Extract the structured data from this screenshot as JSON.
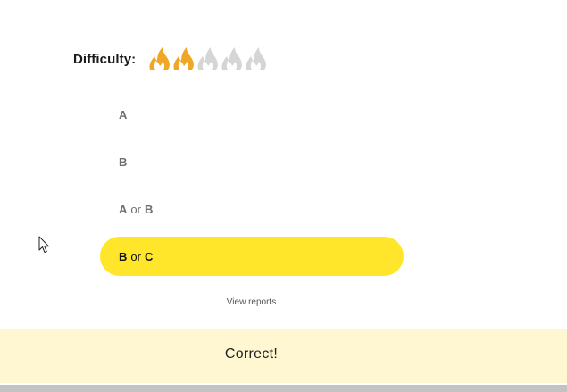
{
  "difficulty": {
    "label": "Difficulty:",
    "level": 2,
    "max": 5,
    "icon": "flame-icon",
    "active_color": "#f0a725",
    "inactive_color": "#d5d5d5"
  },
  "options": [
    {
      "first": "A",
      "join": "",
      "second": ""
    },
    {
      "first": "B",
      "join": "",
      "second": ""
    },
    {
      "first": "A",
      "join": "or",
      "second": "B"
    },
    {
      "first": "B",
      "join": "or",
      "second": "C"
    }
  ],
  "selected_option_index": 3,
  "selected_color": "#ffe62b",
  "view_reports_label": "View reports",
  "feedback": {
    "text": "Correct!",
    "background": "#fff7d2"
  }
}
